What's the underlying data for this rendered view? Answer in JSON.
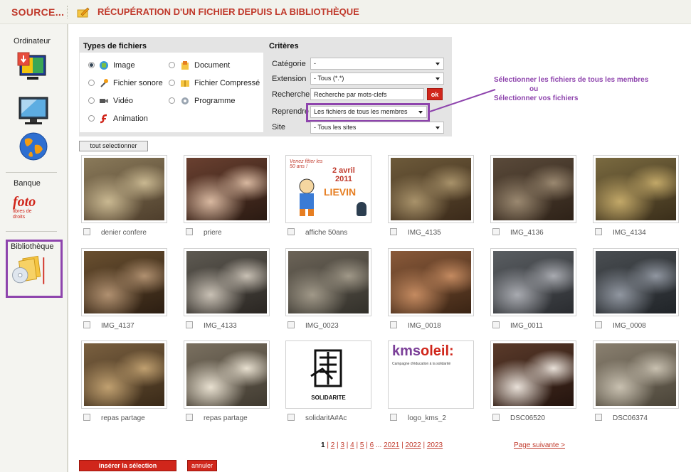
{
  "header": {
    "source_label": "SOURCE...",
    "title": "RÉCUPÉRATION D'UN FICHIER DEPUIS LA BIBLIOTHÈQUE"
  },
  "sidebar": {
    "items": [
      {
        "label": "Ordinateur"
      },
      {
        "label": "Banque",
        "logo_text": "foto",
        "logo_sub": "libres de droits"
      },
      {
        "label": "Bibliothèque"
      }
    ]
  },
  "filters": {
    "types_heading": "Types de fichiers",
    "types": [
      {
        "label": "Image",
        "selected": true
      },
      {
        "label": "Document",
        "selected": false
      },
      {
        "label": "Fichier sonore",
        "selected": false
      },
      {
        "label": "Fichier Compressé",
        "selected": false
      },
      {
        "label": "Vidéo",
        "selected": false
      },
      {
        "label": "Programme",
        "selected": false
      },
      {
        "label": "Animation",
        "selected": false
      }
    ],
    "criteria_heading": "Critères",
    "categorie_label": "Catégorie",
    "categorie_value": "-",
    "extension_label": "Extension",
    "extension_value": "- Tous (*.*)",
    "recherche_label": "Recherche",
    "recherche_value": "Recherche par mots-clefs",
    "ok_label": "ok",
    "reprendre_label": "Reprendre",
    "reprendre_value": "Les fichiers de tous les membres",
    "site_label": "Site",
    "site_value": "- Tous les sites"
  },
  "callout": {
    "line1": "Sélectionner les fichiers de tous les membres",
    "line2": "ou",
    "line3": "Sélectionner vos fichiers"
  },
  "select_all_label": "tout selectionner",
  "thumbnails": [
    {
      "name": "denier confere"
    },
    {
      "name": "priere"
    },
    {
      "name": "affiche 50ans",
      "poster_line1": "Venez fêter les 50 ans !",
      "poster_line2": "2 avril",
      "poster_line3": "2011",
      "poster_line4": "LIEVIN"
    },
    {
      "name": "IMG_4135"
    },
    {
      "name": "IMG_4136"
    },
    {
      "name": "IMG_4134"
    },
    {
      "name": "IMG_4137"
    },
    {
      "name": "IMG_4133"
    },
    {
      "name": "IMG_0023"
    },
    {
      "name": "IMG_0018"
    },
    {
      "name": "IMG_0011"
    },
    {
      "name": "IMG_0008"
    },
    {
      "name": "repas partage"
    },
    {
      "name": "repas partage"
    },
    {
      "name": "solidaritA#Ac",
      "logo_text": "SOLIDARITE"
    },
    {
      "name": "logo_kms_2",
      "logo_text": "kms",
      "logo_text2": "oleil:",
      "logo_sub": "Campagne d'éducation à la solidarité"
    },
    {
      "name": "DSC06520"
    },
    {
      "name": "DSC06374"
    }
  ],
  "pagination": {
    "current": "1",
    "pages": [
      "2",
      "3",
      "4",
      "5",
      "6"
    ],
    "ellipsis": "...",
    "years": [
      "2021",
      "2022",
      "2023"
    ],
    "next_label": "Page suivante >"
  },
  "actions": {
    "insert_label": "insérer la sélection",
    "cancel_label": "annuler"
  }
}
